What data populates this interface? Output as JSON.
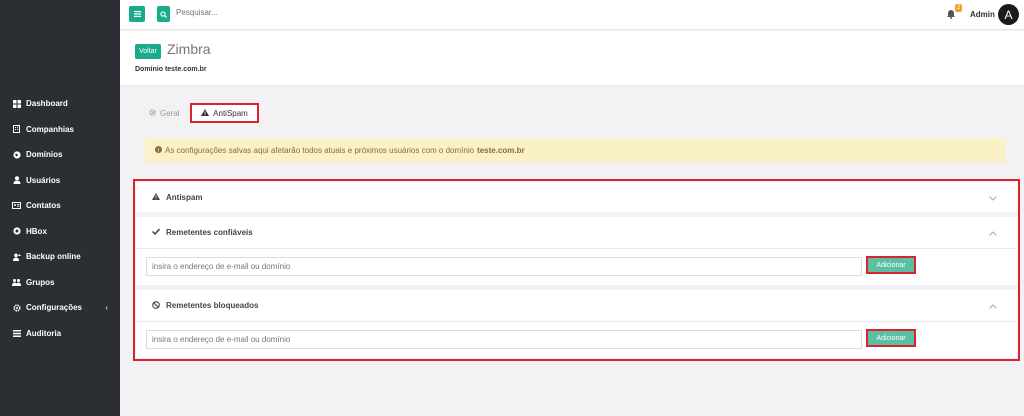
{
  "topbar": {
    "search_placeholder": "Pesquisar...",
    "notification_count": "2",
    "user_name": "Admin",
    "avatar_initial": "A"
  },
  "sidebar": {
    "items": [
      {
        "label": "Dashboard",
        "icon": "grid-icon"
      },
      {
        "label": "Companhias",
        "icon": "building-icon"
      },
      {
        "label": "Domínios",
        "icon": "globe-icon"
      },
      {
        "label": "Usuários",
        "icon": "user-icon"
      },
      {
        "label": "Contatos",
        "icon": "address-card-icon"
      },
      {
        "label": "HBox",
        "icon": "hbox-icon"
      },
      {
        "label": "Backup online",
        "icon": "upload-user-icon"
      },
      {
        "label": "Grupos",
        "icon": "users-icon"
      },
      {
        "label": "Configurações",
        "icon": "gear-icon"
      },
      {
        "label": "Auditoria",
        "icon": "list-icon"
      }
    ]
  },
  "header": {
    "back_label": "Voltar",
    "title": "Zimbra",
    "domain_line": "Domínio teste.com.br"
  },
  "tabs": [
    {
      "label": "Geral",
      "icon": "gear-icon"
    },
    {
      "label": "AntiSpam",
      "icon": "warning-icon"
    }
  ],
  "alert": {
    "text": "As configurações salvas aqui afetarão todos atuais e próximos usuários com o domínio",
    "domain": "teste.com.br"
  },
  "panels": {
    "antispam": {
      "title": "Antispam"
    },
    "trusted": {
      "title": "Remetentes confiáveis",
      "placeholder": "insira o endereço de e-mail ou domínio",
      "button": "Adicionar"
    },
    "blocked": {
      "title": "Remetentes bloqueados",
      "placeholder": "insira o endereço de e-mail ou domínio",
      "button": "Adicionar"
    }
  },
  "colors": {
    "accent": "#1aab8a",
    "highlight": "#d9232e",
    "sidebar": "#2b2f33"
  }
}
